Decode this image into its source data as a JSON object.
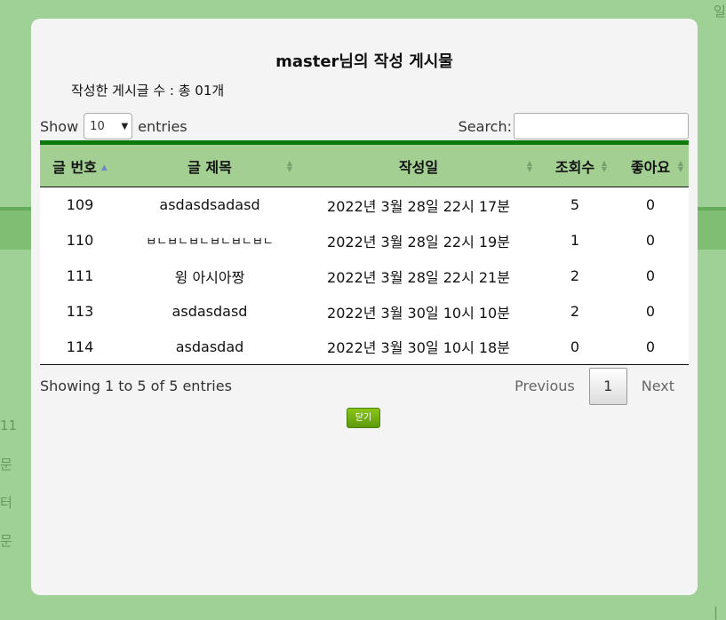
{
  "modal": {
    "title": "master님의 작성 게시물",
    "post_count_label": "작성한 게시글 수 : 총 01개"
  },
  "length": {
    "show_label": "Show",
    "value": "10",
    "entries_label": "entries"
  },
  "search": {
    "label": "Search:",
    "value": ""
  },
  "table": {
    "columns": [
      "글 번호",
      "글 제목",
      "작성일",
      "조회수",
      "좋아요"
    ],
    "rows": [
      [
        "109",
        "asdasdsadasd",
        "2022년 3월 28일 22시 17분",
        "5",
        "0"
      ],
      [
        "110",
        "ㅂㄴㅂㄴㅂㄴㅂㄴㅂㄴㅂㄴ",
        "2022년 3월 28일 22시 19분",
        "1",
        "0"
      ],
      [
        "111",
        "윙 아시아짱",
        "2022년 3월 28일 22시 21분",
        "2",
        "0"
      ],
      [
        "113",
        "asdasdasd",
        "2022년 3월 30일 10시 10분",
        "2",
        "0"
      ],
      [
        "114",
        "asdasdad",
        "2022년 3월 30일 10시 18분",
        "0",
        "0"
      ]
    ]
  },
  "footer": {
    "info": "Showing 1 to 5 of 5 entries",
    "previous": "Previous",
    "current_page": "1",
    "next": "Next",
    "close_label": "닫기"
  },
  "background_fragments": [
    "일",
    "11",
    "문",
    "터",
    "문",
    "|"
  ],
  "colors": {
    "overlay": "#7abe6e",
    "header_bg": "#a3cf93",
    "header_border": "#0b7a0b",
    "close_button": "#6aa812"
  }
}
